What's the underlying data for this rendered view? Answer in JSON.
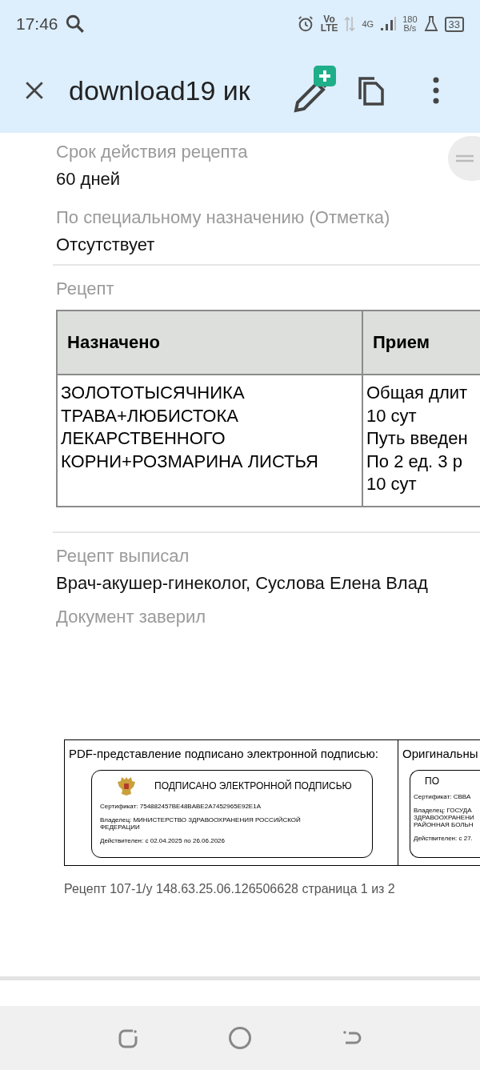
{
  "status_bar": {
    "time": "17:46",
    "volte": [
      "Vo",
      "LTE"
    ],
    "network": "4G",
    "speed": [
      "180",
      "B/s"
    ],
    "battery": "33"
  },
  "toolbar": {
    "title": "download19 ик"
  },
  "fields": [
    {
      "label": "Срок действия рецепта",
      "value": "60 дней"
    },
    {
      "label": "По специальному назначению (Отметка)",
      "value": "Отсутствует"
    }
  ],
  "recipe": {
    "label": "Рецепт",
    "columns": [
      "Назначено",
      "Прием"
    ],
    "rows": [
      [
        "ЗОЛОТОТЫСЯЧНИКА\nТРАВА+ЛЮБИСТОКА\nЛЕКАРСТВЕННОГО\nКОРНИ+РОЗМАРИНА ЛИСТЬЯ",
        "Общая длит\n10 сут\nПуть введен\nПо 2 ед. 3 р\n10 сут"
      ]
    ]
  },
  "signer_fields": [
    {
      "label": "Рецепт выписал",
      "value": "Врач-акушер-гинеколог, Суслова Елена Влад"
    },
    {
      "label": "Документ заверил"
    }
  ],
  "signatures": [
    {
      "heading": "PDF-представление подписано электронной подписью:",
      "stamp_title": "ПОДПИСАНО ЭЛЕКТРОННОЙ ПОДПИСЬЮ",
      "emblem": true,
      "lines": [
        "Сертификат: 754882457BE48BABE2A7452965E92E1A",
        "Владелец: МИНИСТЕРСТВО ЗДРАВООХРАНЕНИЯ РОССИЙСКОЙ\nФЕДЕРАЦИИ",
        "Действителен: с 02.04.2025 по 26.06.2026"
      ]
    },
    {
      "heading": "Оригинальны",
      "stamp_title": "ПО",
      "emblem": false,
      "lines": [
        "Сертификат: СВВА",
        "Владелец: ГОСУДА\nЗДРАВООХРАНЕНИ\nРАЙОННАЯ БОЛЬН",
        "Действителен: с 27."
      ]
    }
  ],
  "footer": "Рецепт 107-1/у 148.63.25.06.126506628 страница 1 из 2"
}
